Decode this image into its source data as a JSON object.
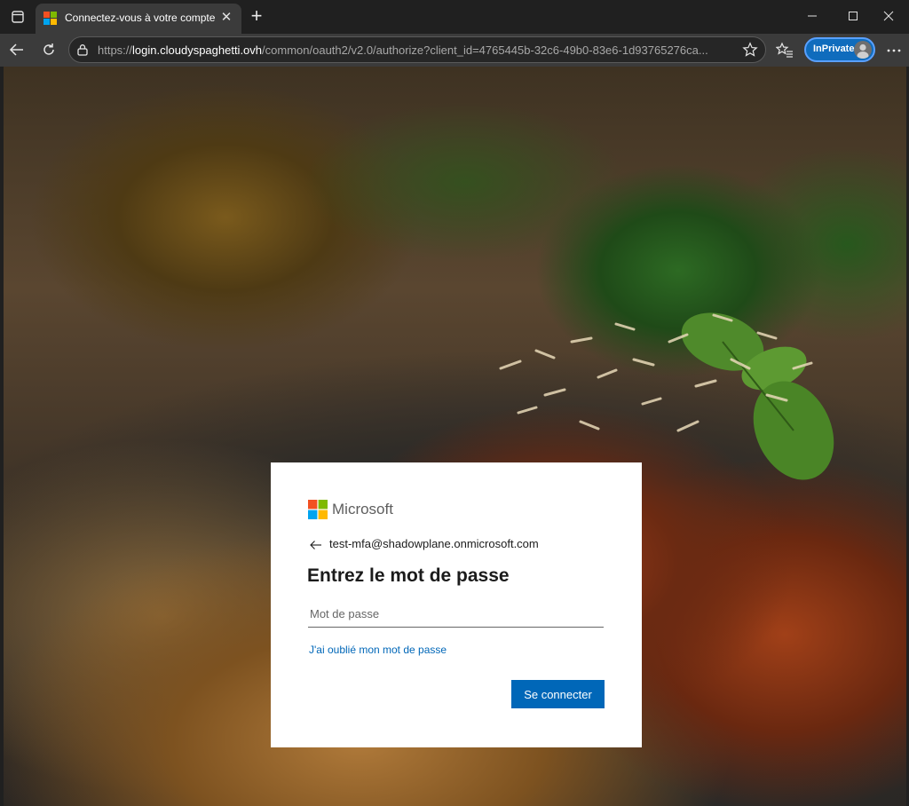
{
  "browser": {
    "tab": {
      "title": "Connectez-vous à votre compte",
      "close_glyph": "✕",
      "favicon": "microsoft-logo-icon"
    },
    "new_tab_glyph": "+",
    "address": {
      "scheme": "https://",
      "host": "login.cloudyspaghetti.ovh",
      "path": "/common/oauth2/v2.0/authorize?client_id=4765445b-32c6-49b0-83e6-1d93765276ca..."
    },
    "inprivate_label": "InPrivate",
    "colors": {
      "chrome_dark": "#202020",
      "toolbar": "#3b3b3b",
      "inprivate_accent": "#0f6cbd"
    }
  },
  "signin": {
    "brand": "Microsoft",
    "back_glyph": "←",
    "identity": "test-mfa@shadowplane.onmicrosoft.com",
    "heading": "Entrez le mot de passe",
    "password": {
      "value": "",
      "placeholder": "Mot de passe"
    },
    "forgot_link": "J'ai oublié mon mot de passe",
    "submit_label": "Se connecter",
    "colors": {
      "primary": "#0067b8",
      "logo_red": "#f25022",
      "logo_green": "#7fba00",
      "logo_blue": "#00a4ef",
      "logo_yellow": "#ffb900"
    }
  }
}
